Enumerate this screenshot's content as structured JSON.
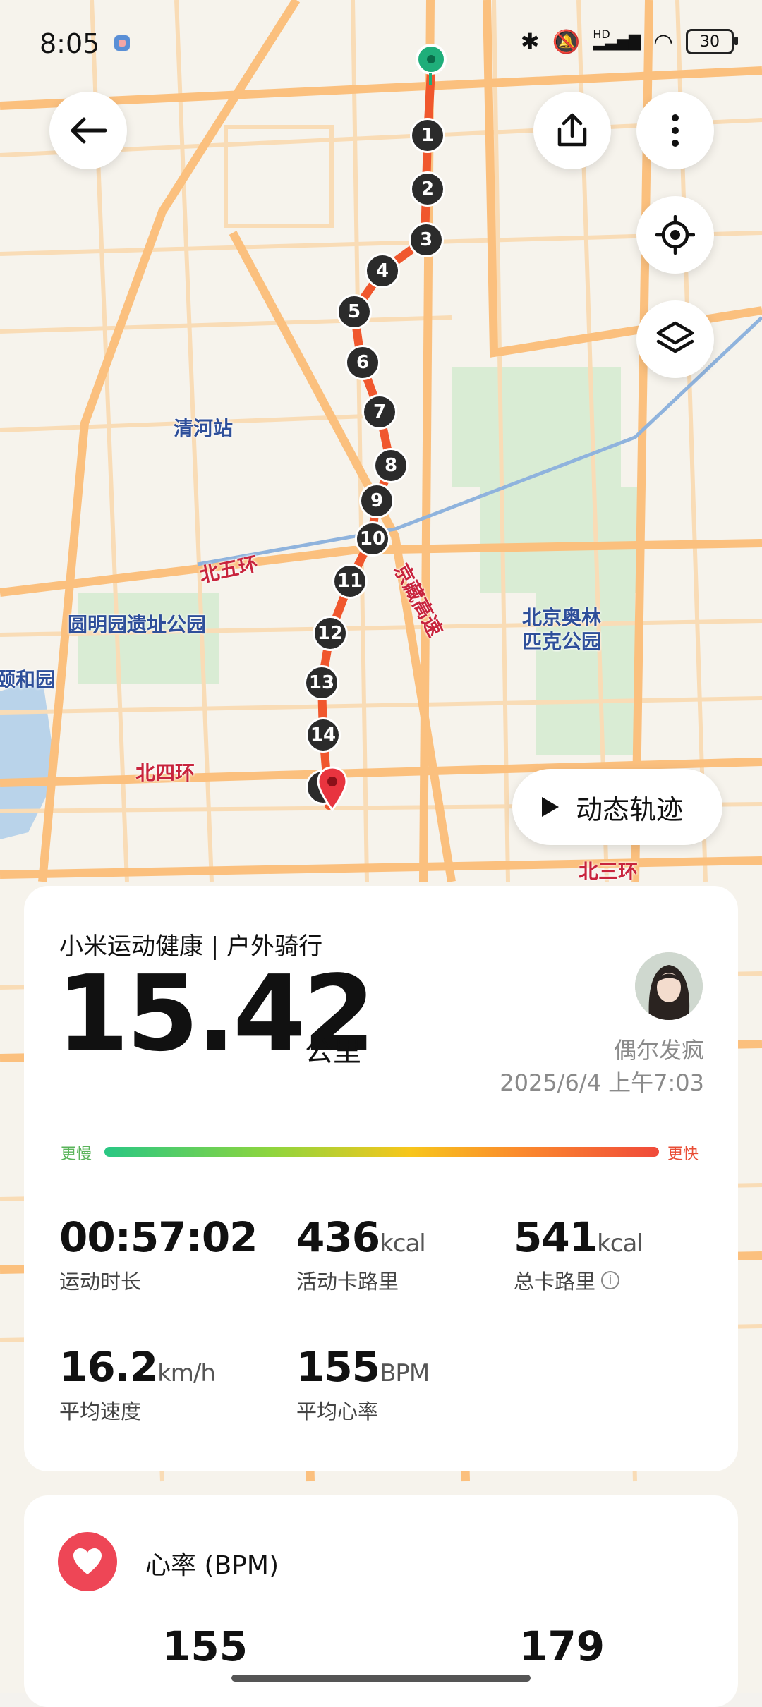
{
  "status_bar": {
    "time": "8:05",
    "battery": "30",
    "network": "HD",
    "wifi_level": "6"
  },
  "map": {
    "labels": {
      "qinghe": "清河站",
      "north_5th_ring": "北五环",
      "jingzang": "京藏高速",
      "yuanmingyuan": "圆明园遗址公园",
      "olympic_line1": "北京奥林",
      "olympic_line2": "匹克公园",
      "summer_palace": "颐和园",
      "north_4th_ring": "北四环",
      "north_3rd_ring": "北三环"
    },
    "route_markers": [
      "1",
      "2",
      "3",
      "4",
      "5",
      "6",
      "7",
      "8",
      "9",
      "10",
      "11",
      "12",
      "13",
      "14"
    ],
    "route_color": "#f0572d"
  },
  "buttons": {
    "back": "back",
    "share": "share",
    "more": "more",
    "locate": "locate",
    "layers": "layers",
    "replay_label": "动态轨迹"
  },
  "summary": {
    "title": "小米运动健康 | 户外骑行",
    "distance": "15.42",
    "distance_unit": "公里",
    "user": "偶尔发疯",
    "datetime": "2025/6/4 上午7:03",
    "speed_slow": "更慢",
    "speed_fast": "更快",
    "stats": {
      "duration": {
        "value": "00:57:02",
        "unit": "",
        "label": "运动时长"
      },
      "active_kcal": {
        "value": "436",
        "unit": "kcal",
        "label": "活动卡路里"
      },
      "total_kcal": {
        "value": "541",
        "unit": "kcal",
        "label": "总卡路里"
      },
      "avg_speed": {
        "value": "16.2",
        "unit": "km/h",
        "label": "平均速度"
      },
      "avg_hr": {
        "value": "155",
        "unit": "BPM",
        "label": "平均心率"
      }
    }
  },
  "heart_rate": {
    "title": "心率 (BPM)",
    "avg": "155",
    "max": "179"
  },
  "colors": {
    "accent_green": "#1fae7a",
    "heart_red": "#ee4656",
    "route_orange": "#f0572d"
  }
}
